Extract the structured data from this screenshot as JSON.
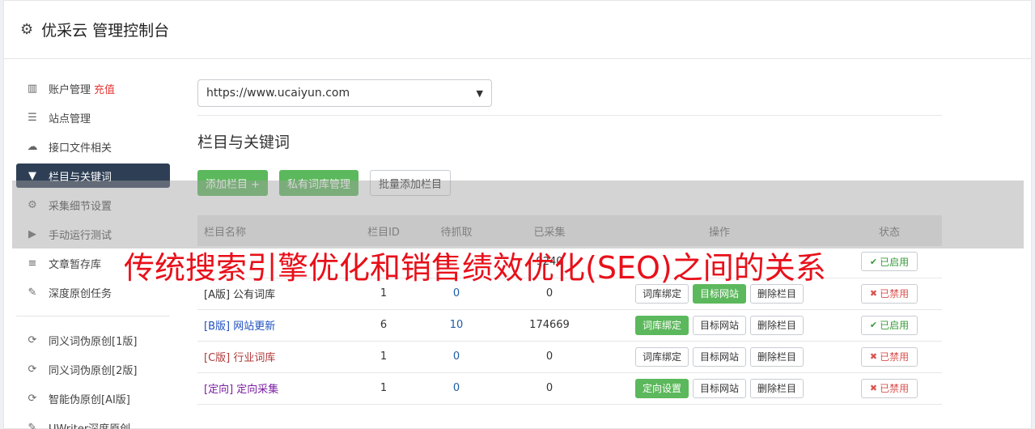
{
  "header": {
    "title": "优采云 管理控制台"
  },
  "sidebar": {
    "items": [
      {
        "label": "账户管理",
        "extra": "充值",
        "icon": "bar-chart-icon"
      },
      {
        "label": "站点管理",
        "icon": "server-icon"
      },
      {
        "label": "接口文件相关",
        "icon": "cloud-upload-icon"
      },
      {
        "label": "栏目与关键词",
        "icon": "filter-icon",
        "active": true
      },
      {
        "label": "采集细节设置",
        "icon": "gears-icon"
      },
      {
        "label": "手动运行测试",
        "icon": "play-circle-icon"
      },
      {
        "label": "文章暂存库",
        "icon": "database-icon"
      },
      {
        "label": "深度原创任务",
        "icon": "edit-icon"
      }
    ],
    "tools": [
      {
        "label": "同义词伪原创[1版]",
        "icon": "refresh-icon"
      },
      {
        "label": "同义词伪原创[2版]",
        "icon": "refresh-icon"
      },
      {
        "label": "智能伪原创[AI版]",
        "icon": "refresh-icon"
      },
      {
        "label": "UWriter深度原创",
        "icon": "edit-icon"
      }
    ]
  },
  "main": {
    "site_select": "https://www.ucaiyun.com",
    "section_title": "栏目与关键词",
    "buttons": {
      "add": "添加栏目 +",
      "private_lib": "私有词库管理",
      "batch_add": "批量添加栏目"
    },
    "table": {
      "headers": [
        "栏目名称",
        "栏目ID",
        "待抓取",
        "已采集",
        "操作",
        "状态"
      ],
      "rows": [
        {
          "name": "[A版] 公有词库",
          "name_color": "#333333",
          "id": "1",
          "pending": "0",
          "collected": "0",
          "op1": "词库绑定",
          "op1_style": "w",
          "op2": "目标网站",
          "op2_style": "g",
          "op3": "删除栏目",
          "status": "已禁用",
          "status_type": "off"
        },
        {
          "name": "[B版] 网站更新",
          "name_color": "#1e4fbf",
          "id": "6",
          "pending": "10",
          "collected": "174669",
          "op1": "词库绑定",
          "op1_style": "g",
          "op2": "目标网站",
          "op2_style": "w",
          "op3": "删除栏目",
          "status": "已启用",
          "status_type": "on"
        },
        {
          "name": "[C版] 行业词库",
          "name_color": "#b03a3a",
          "id": "1",
          "pending": "0",
          "collected": "0",
          "op1": "词库绑定",
          "op1_style": "w",
          "op2": "目标网站",
          "op2_style": "w",
          "op3": "删除栏目",
          "status": "已禁用",
          "status_type": "off"
        },
        {
          "name": "[定向] 定向采集",
          "name_color": "#7a1fa2",
          "id": "1",
          "pending": "0",
          "collected": "0",
          "op1": "定向设置",
          "op1_style": "g",
          "op2": "目标网站",
          "op2_style": "w",
          "op3": "删除栏目",
          "status": "已禁用",
          "status_type": "off"
        }
      ],
      "partial_row": {
        "collected": "9240",
        "status": "已启用"
      }
    }
  },
  "watermark": "传统搜索引擎优化和销售绩效优化(SEO)之间的关系",
  "colors": {
    "sidebar_active": "#2e3f55",
    "green": "#5cb85c",
    "watermark": "#e8101a"
  }
}
